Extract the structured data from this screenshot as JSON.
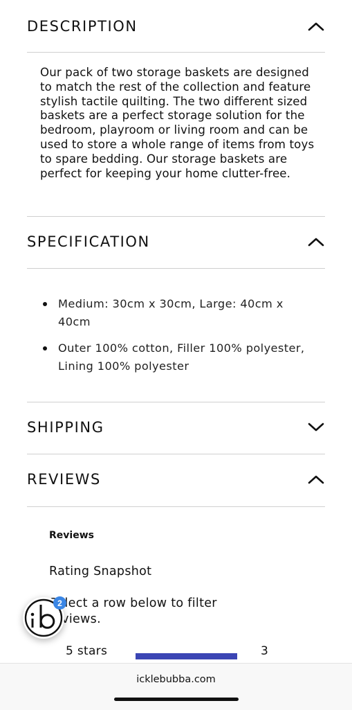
{
  "sections": {
    "description": {
      "title": "DESCRIPTION",
      "expanded": true,
      "body": "Our pack of two storage baskets are designed to match the rest of the collection and feature stylish tactile quilting. The two different sized baskets are a perfect storage solution for the bedroom, playroom or living room and can be used to store a whole range of items from toys to spare bedding. Our storage baskets are perfect for keeping your home clutter-free."
    },
    "specification": {
      "title": "SPECIFICATION",
      "expanded": true,
      "items": [
        "Medium: 30cm x 30cm, Large: 40cm x 40cm",
        "Outer 100% cotton, Filler 100% polyester, Lining 100% polyester"
      ]
    },
    "shipping": {
      "title": "SHIPPING",
      "expanded": false
    },
    "reviews": {
      "title": "REVIEWS",
      "expanded": true,
      "heading": "Reviews",
      "snapshot_title": "Rating Snapshot",
      "filter_text": "Select a row below to filter reviews.",
      "rows": [
        {
          "label": "5 stars",
          "count": "3",
          "fill_fraction": 1.0
        }
      ]
    }
  },
  "chat_widget": {
    "icon": "ib-logo-icon",
    "notification_count": "2"
  },
  "browser": {
    "url": "icklebubba.com"
  },
  "colors": {
    "rating_bar": "#3b45b4",
    "badge": "#3a86e5"
  }
}
